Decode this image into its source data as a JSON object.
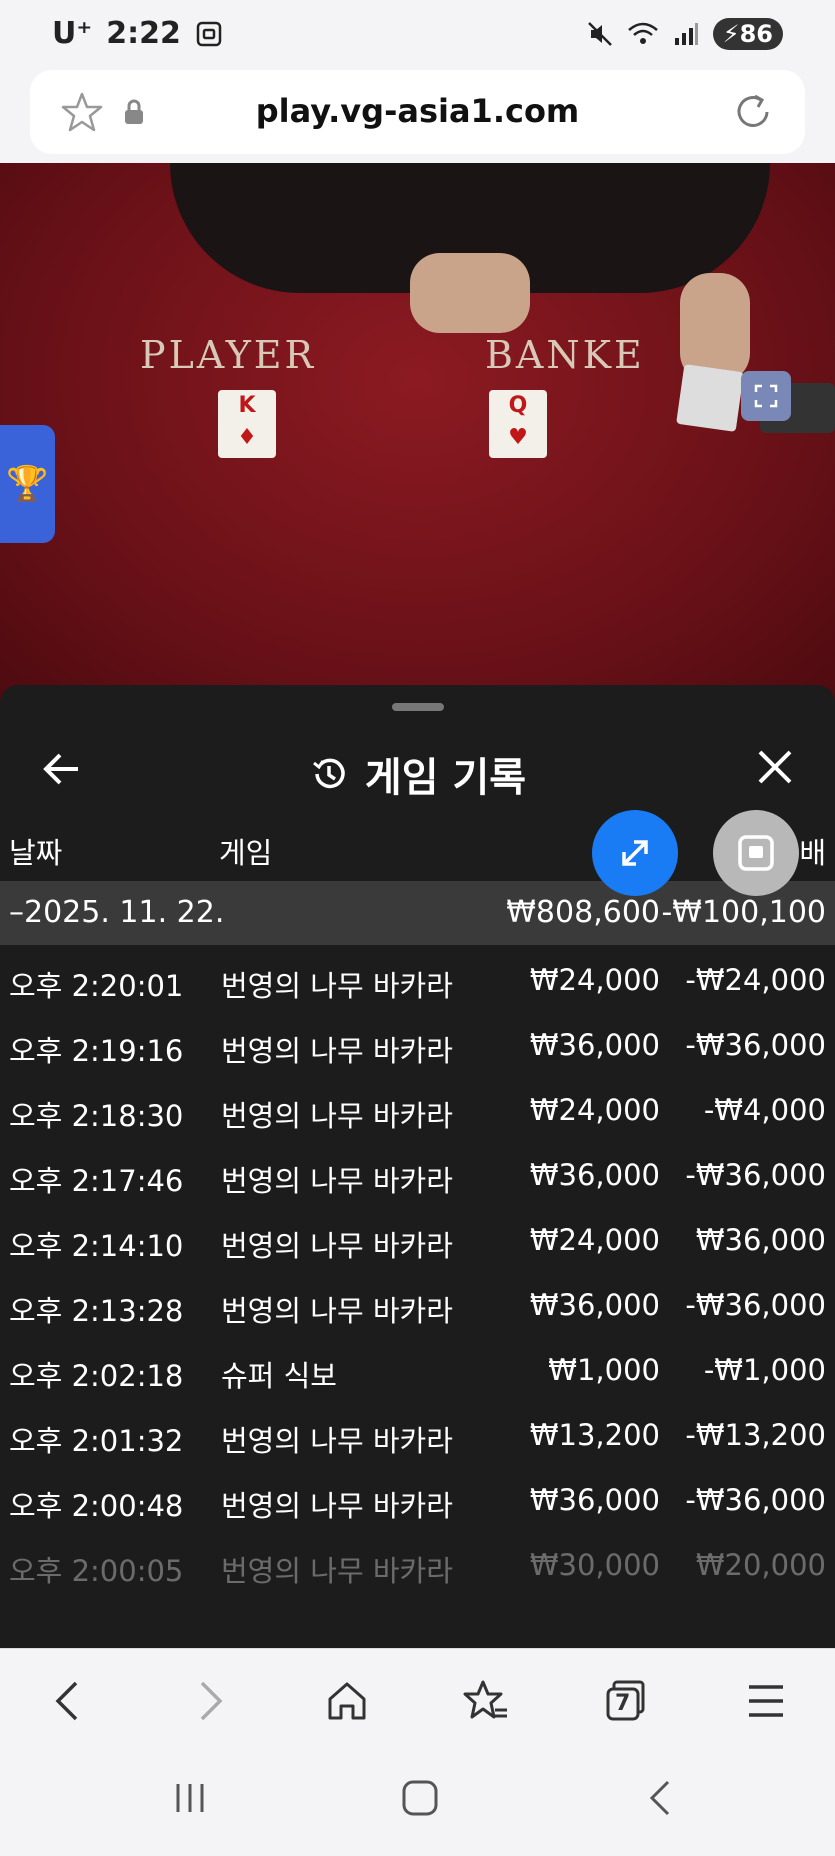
{
  "status_bar": {
    "carrier": "U⁺",
    "time": "2:22",
    "battery": "86"
  },
  "browser": {
    "url": "play.vg-asia1.com"
  },
  "game": {
    "player_label": "PLAYER",
    "banker_label": "BANKE",
    "player_card": {
      "rank": "K",
      "suit": "♦"
    },
    "banker_card": {
      "rank": "Q",
      "suit": "♥"
    }
  },
  "history": {
    "title": "게임 기록",
    "columns": {
      "date": "날짜",
      "game": "게임",
      "payout": "배"
    },
    "group": {
      "date": "–2025. 11. 22.",
      "bet_total": "₩808,600",
      "result_total": "-₩100,100"
    },
    "rows": [
      {
        "time": "오후 2:20:01",
        "game": "번영의 나무 바카라",
        "bet": "₩24,000",
        "result": "-₩24,000"
      },
      {
        "time": "오후 2:19:16",
        "game": "번영의 나무 바카라",
        "bet": "₩36,000",
        "result": "-₩36,000"
      },
      {
        "time": "오후 2:18:30",
        "game": "번영의 나무 바카라",
        "bet": "₩24,000",
        "result": "-₩4,000"
      },
      {
        "time": "오후 2:17:46",
        "game": "번영의 나무 바카라",
        "bet": "₩36,000",
        "result": "-₩36,000"
      },
      {
        "time": "오후 2:14:10",
        "game": "번영의 나무 바카라",
        "bet": "₩24,000",
        "result": "₩36,000"
      },
      {
        "time": "오후 2:13:28",
        "game": "번영의 나무 바카라",
        "bet": "₩36,000",
        "result": "-₩36,000"
      },
      {
        "time": "오후 2:02:18",
        "game": "슈퍼 식보",
        "bet": "₩1,000",
        "result": "-₩1,000"
      },
      {
        "time": "오후 2:01:32",
        "game": "번영의 나무 바카라",
        "bet": "₩13,200",
        "result": "-₩13,200"
      },
      {
        "time": "오후 2:00:48",
        "game": "번영의 나무 바카라",
        "bet": "₩36,000",
        "result": "-₩36,000"
      },
      {
        "time": "오후 2:00:05",
        "game": "번영의 나무 바카라",
        "bet": "₩30,000",
        "result": "₩20,000"
      }
    ]
  },
  "bottom_nav": {
    "tab_count": "7"
  },
  "colors": {
    "accent": "#1a7cf5",
    "sheet_bg": "#1c1c1c",
    "table_red": "#7a1219"
  }
}
